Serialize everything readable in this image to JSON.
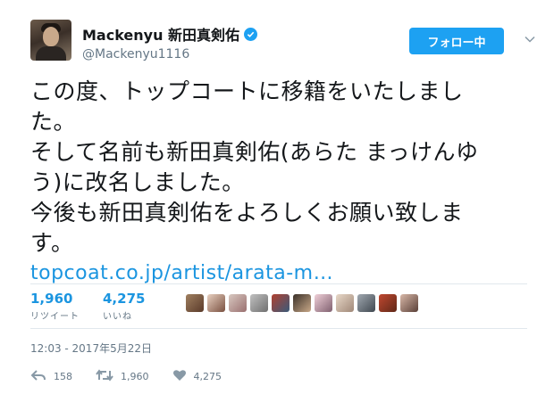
{
  "user": {
    "display_name": "Mackenyu 新田真剣佑",
    "handle": "@Mackenyu1116",
    "follow_label": "フォロー中"
  },
  "tweet": {
    "lines": [
      "この度、トップコートに移籍をいたしまし",
      "た。",
      "そして名前も新田真剣佑(あらた まっけんゆ",
      "う)に改名しました。",
      "今後も新田真剣佑をよろしくお願い致しま",
      "す。"
    ],
    "link": "topcoat.co.jp/artist/arata-m…"
  },
  "stats": {
    "retweets": "1,960",
    "retweets_label": "リツイート",
    "likes": "4,275",
    "likes_label": "いいね"
  },
  "timestamp": "12:03 - 2017年5月22日",
  "actions": {
    "reply_count": "158",
    "retweet_count": "1,960",
    "like_count": "4,275"
  },
  "colors": {
    "accent": "#1da1f2",
    "link": "#1b95e0",
    "muted": "#657786"
  }
}
